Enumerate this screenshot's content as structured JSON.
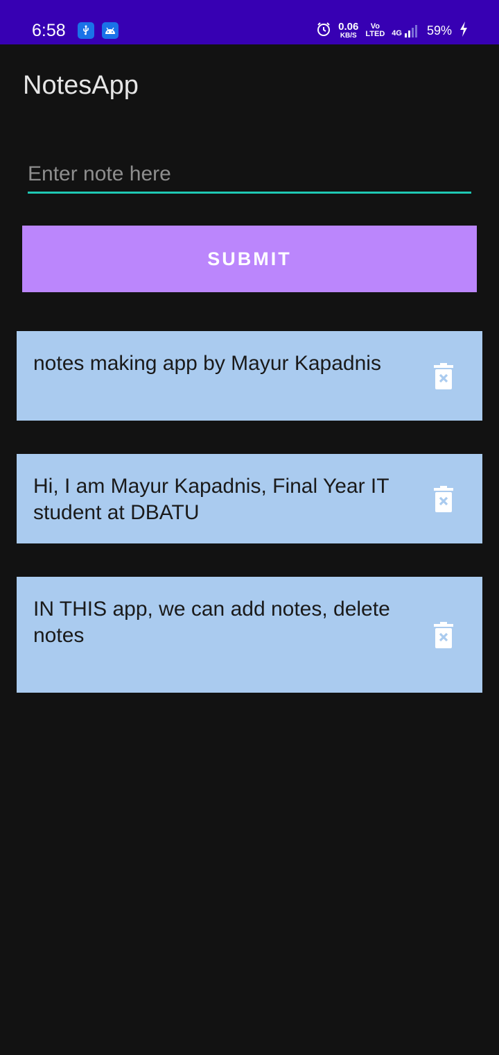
{
  "status_bar": {
    "time": "6:58",
    "speed_value": "0.06",
    "speed_unit": "KB/S",
    "volte_top": "Vo",
    "volte_bottom": "LTED",
    "network": "4G",
    "battery": "59%",
    "icons": [
      "usb-icon",
      "android-icon",
      "alarm-icon",
      "signal-icon",
      "charging-icon"
    ],
    "color": "#3700b3"
  },
  "app_bar": {
    "title": "NotesApp"
  },
  "form": {
    "input_placeholder": "Enter note here",
    "input_value": "",
    "submit_label": "SUBMIT",
    "accent_color": "#1fc8b4",
    "button_color": "#bb86fc"
  },
  "notes": [
    {
      "text": "notes making app by Mayur Kapadnis",
      "icon": "trash-icon"
    },
    {
      "text": "Hi, I am Mayur Kapadnis, Final Year IT student at DBATU",
      "icon": "trash-icon"
    },
    {
      "text": "IN THIS app, we can add notes, delete notes",
      "icon": "trash-icon"
    }
  ],
  "card_color": "#aacbef"
}
